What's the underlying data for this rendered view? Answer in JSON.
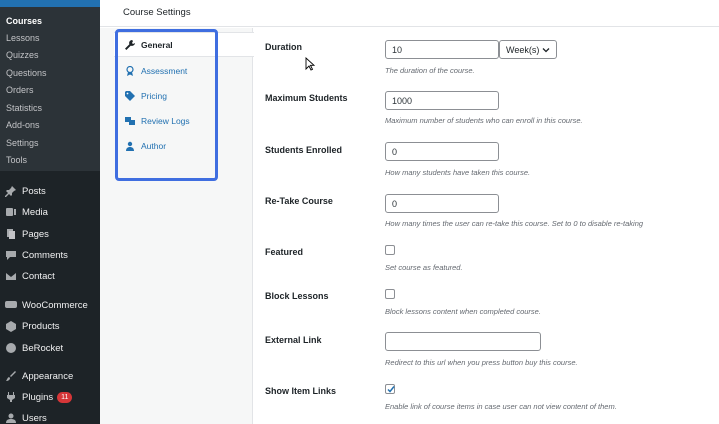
{
  "sidebar": {
    "submenu": [
      "Courses",
      "Lessons",
      "Quizzes",
      "Questions",
      "Orders",
      "Statistics",
      "Add-ons",
      "Settings",
      "Tools"
    ],
    "menu": [
      {
        "label": "Posts",
        "icon": "pin-icon"
      },
      {
        "label": "Media",
        "icon": "media-icon"
      },
      {
        "label": "Pages",
        "icon": "pages-icon"
      },
      {
        "label": "Comments",
        "icon": "comments-icon"
      },
      {
        "label": "Contact",
        "icon": "mail-icon"
      },
      {
        "label": "WooCommerce",
        "icon": "woocommerce-icon"
      },
      {
        "label": "Products",
        "icon": "products-icon"
      },
      {
        "label": "BeRocket",
        "icon": "berocket-icon"
      },
      {
        "label": "Appearance",
        "icon": "brush-icon"
      },
      {
        "label": "Plugins",
        "icon": "plugin-icon",
        "badge": "11"
      },
      {
        "label": "Users",
        "icon": "users-icon"
      }
    ]
  },
  "header": {
    "title": "Course Settings"
  },
  "tabs": [
    {
      "label": "General",
      "icon": "wrench-icon",
      "active": true
    },
    {
      "label": "Assessment",
      "icon": "award-icon"
    },
    {
      "label": "Pricing",
      "icon": "tag-icon"
    },
    {
      "label": "Review Logs",
      "icon": "review-icon"
    },
    {
      "label": "Author",
      "icon": "author-icon"
    }
  ],
  "fields": {
    "duration": {
      "label": "Duration",
      "value": "10",
      "unit": "Week(s)",
      "desc": "The duration of the course."
    },
    "max_students": {
      "label": "Maximum Students",
      "value": "1000",
      "desc": "Maximum number of students who can enroll in this course."
    },
    "students_enrolled": {
      "label": "Students Enrolled",
      "value": "0",
      "desc": "How many students have taken this course."
    },
    "retake": {
      "label": "Re-Take Course",
      "value": "0",
      "desc": "How many times the user can re-take this course. Set to 0 to disable re-taking"
    },
    "featured": {
      "label": "Featured",
      "checked": false,
      "desc": "Set course as featured."
    },
    "block_lessons": {
      "label": "Block Lessons",
      "checked": false,
      "desc": "Block lessons content when completed course."
    },
    "external_link": {
      "label": "External Link",
      "value": "",
      "desc": "Redirect to this url when you press button buy this course."
    },
    "show_item_links": {
      "label": "Show Item Links",
      "checked": true,
      "desc": "Enable link of course items in case user can not view content of them."
    }
  },
  "colors": {
    "sidebar_bg": "#1d2327",
    "accent": "#2271b1",
    "highlight": "#3f6ee0",
    "badge": "#d63638"
  }
}
